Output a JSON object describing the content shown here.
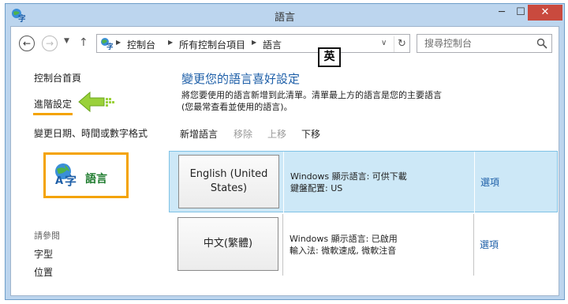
{
  "window": {
    "title": "語言",
    "min_label": "─",
    "max_label": "☐",
    "close_label": "✕"
  },
  "nav": {
    "back_label": "←",
    "forward_label": "→",
    "dropdown_label": "▼",
    "up_label": "↑",
    "breadcrumbs": [
      "控制台",
      "所有控制台項目",
      "語言"
    ],
    "address_dropdown": "∨",
    "refresh_label": "↻",
    "search_placeholder": "搜尋控制台"
  },
  "ime_indicator": "英",
  "sidebar": {
    "home": "控制台首頁",
    "advanced": "進階設定",
    "datetime": "變更日期、時間或數字格式",
    "language_label": "語言",
    "see_also": "請參閱",
    "link_font": "字型",
    "link_location": "位置"
  },
  "main": {
    "title": "變更您的語言喜好設定",
    "description_line1": "將您要使用的語言新增到此清單。清單最上方的語言是您的主要語言",
    "description_line2": "(您最常查看並使用的語言)。",
    "toolbar": {
      "add": "新增語言",
      "remove": "移除",
      "move_up": "上移",
      "move_down": "下移"
    },
    "languages": [
      {
        "name": "English (United States)",
        "info_line1": "Windows 顯示語言: 可供下載",
        "info_line2": "鍵盤配置: US",
        "options": "選項"
      },
      {
        "name": "中文(繁體)",
        "info_line1": "Windows 顯示語言: 已啟用",
        "info_line2": "輸入法: 微軟速成, 微軟注音",
        "options": "選項"
      }
    ]
  },
  "colors": {
    "accent_blue": "#1e5fa8",
    "highlight_orange": "#f4a300",
    "selected_row": "#cde8f7",
    "language_green": "#1c7a2c",
    "close_red": "#c94a3e"
  }
}
